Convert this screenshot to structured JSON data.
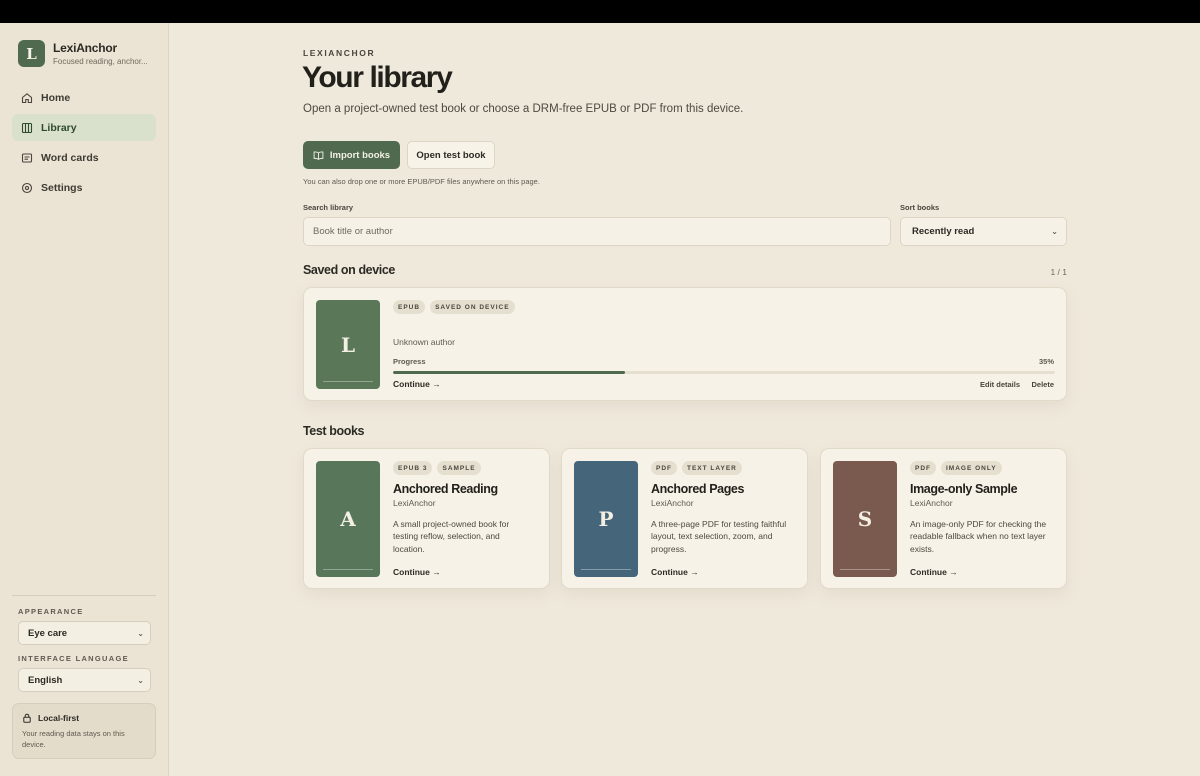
{
  "app": {
    "name": "LexiAnchor",
    "tagline": "Focused reading, anchor...",
    "logo_letter": "L"
  },
  "nav": [
    {
      "label": "Home",
      "icon": "home-icon",
      "active": false
    },
    {
      "label": "Library",
      "icon": "library-icon",
      "active": true
    },
    {
      "label": "Word cards",
      "icon": "cards-icon",
      "active": false
    },
    {
      "label": "Settings",
      "icon": "gear-icon",
      "active": false
    }
  ],
  "sidebar": {
    "appearance_label": "APPEARANCE",
    "appearance_value": "Eye care",
    "language_label": "INTERFACE LANGUAGE",
    "language_value": "English",
    "local_title": "Local-first",
    "local_text": "Your reading data stays on this device."
  },
  "header": {
    "eyebrow": "LEXIANCHOR",
    "title": "Your library",
    "subtitle": "Open a project-owned test book or choose a DRM-free EPUB or PDF from this device."
  },
  "actions": {
    "import_label": "Import books",
    "open_test_label": "Open test book",
    "hint": "You can also drop one or more EPUB/PDF files anywhere on this page."
  },
  "search": {
    "label": "Search library",
    "placeholder": "Book title or author",
    "value": ""
  },
  "sort": {
    "label": "Sort books",
    "value": "Recently read"
  },
  "saved": {
    "title": "Saved on device",
    "pager": "1 / 1",
    "book": {
      "cover_letter": "L",
      "cover_color": "#5a7758",
      "badges": [
        "EPUB",
        "SAVED ON DEVICE"
      ],
      "author": "Unknown author",
      "progress_label": "Progress",
      "progress_text": "35%",
      "progress": 0.35,
      "continue": "Continue →",
      "edit": "Edit details",
      "delete": "Delete"
    }
  },
  "test_books": {
    "title": "Test books",
    "items": [
      {
        "cover_letter": "A",
        "cover_color": "#58765a",
        "badges": [
          "EPUB 3",
          "SAMPLE"
        ],
        "title": "Anchored Reading",
        "author": "LexiAnchor",
        "description": "A small project-owned book for testing reflow, selection, and location.",
        "continue": "Continue →"
      },
      {
        "cover_letter": "P",
        "cover_color": "#45667a",
        "badges": [
          "PDF",
          "TEXT LAYER"
        ],
        "title": "Anchored Pages",
        "author": "LexiAnchor",
        "description": "A three-page PDF for testing faithful layout, text selection, zoom, and progress.",
        "continue": "Continue →"
      },
      {
        "cover_letter": "S",
        "cover_color": "#7a5a4e",
        "badges": [
          "PDF",
          "IMAGE ONLY"
        ],
        "title": "Image-only Sample",
        "author": "LexiAnchor",
        "description": "An image-only PDF for checking the readable fallback when no text layer exists.",
        "continue": "Continue →"
      }
    ]
  }
}
